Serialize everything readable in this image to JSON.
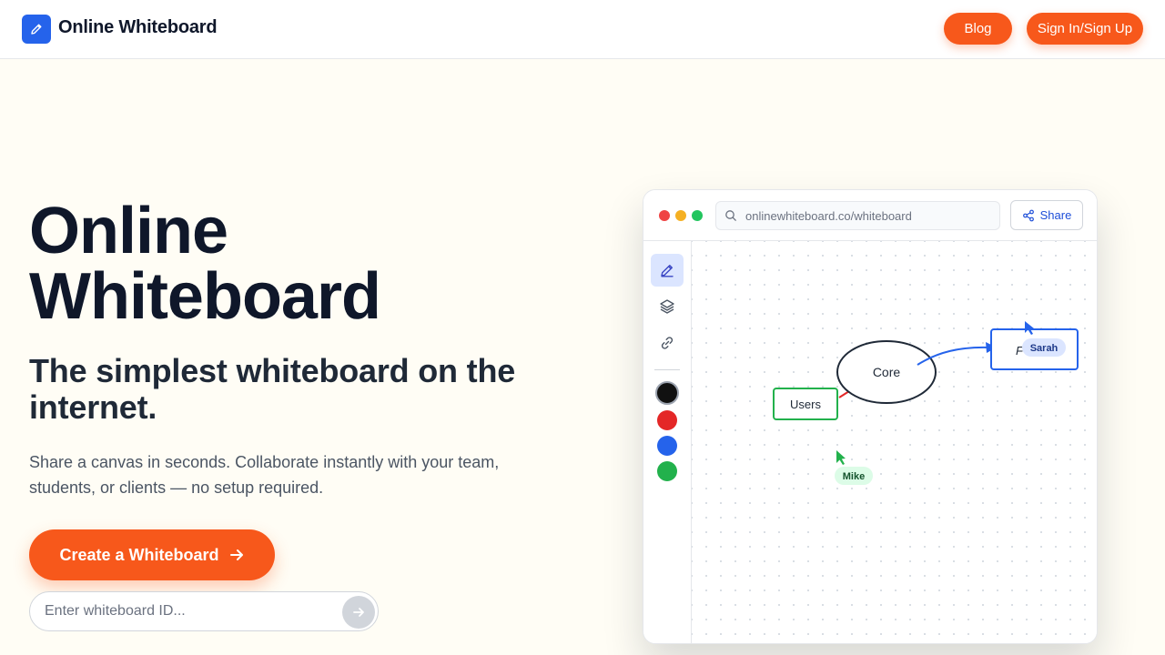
{
  "nav": {
    "brand": "Online Whiteboard",
    "blog_label": "Blog",
    "signin_label": "Sign In/Sign Up"
  },
  "hero": {
    "title_line1": "Online",
    "title_line2": "Whiteboard",
    "subtitle": "The simplest whiteboard on the internet.",
    "description": "Share a canvas in seconds. Collaborate instantly with your team, students, or clients — no setup required.",
    "cta_label": "Create a Whiteboard",
    "id_placeholder": "Enter whiteboard ID..."
  },
  "mock": {
    "url": "onlinewhiteboard.co/whiteboard",
    "share_label": "Share",
    "tools": [
      "pencil-icon",
      "layers-icon",
      "link-icon"
    ],
    "active_tool": "pencil-icon",
    "swatches": [
      "#111111",
      "#e42727",
      "#2563eb",
      "#22b14c"
    ],
    "selected_swatch": "#111111",
    "canvas": {
      "node_core": "Core",
      "node_users": "Users",
      "node_right_partial": "F",
      "cursor_sarah": "Sarah",
      "cursor_mike": "Mike"
    }
  },
  "colors": {
    "accent_orange": "#f7581b",
    "brand_blue": "#2563eb",
    "background": "#fffdf5"
  }
}
